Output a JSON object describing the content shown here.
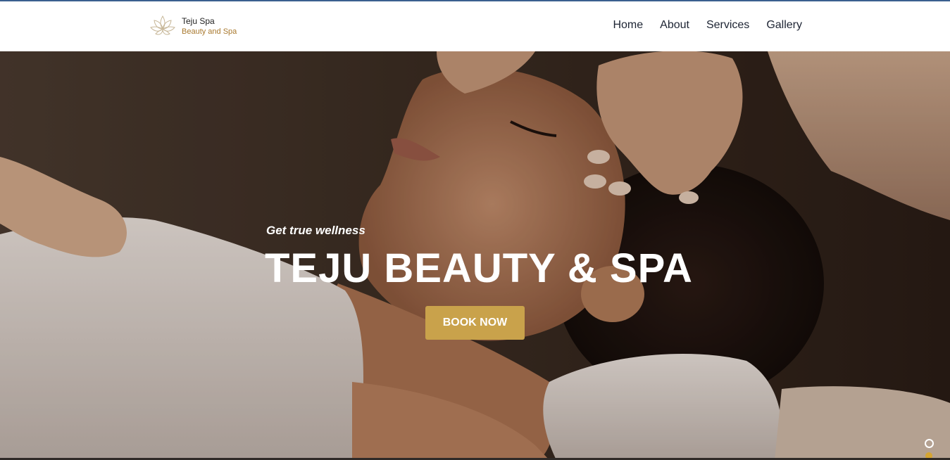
{
  "brand": {
    "name": "Teju Spa",
    "tagline": "Beauty and Spa",
    "logo_icon": "lotus-icon"
  },
  "nav": {
    "items": [
      {
        "label": "Home"
      },
      {
        "label": "About"
      },
      {
        "label": "Services"
      },
      {
        "label": "Gallery"
      }
    ]
  },
  "hero": {
    "subtitle": "Get true wellness",
    "title": "TEJU BEAUTY & SPA",
    "button_label": "BOOK NOW",
    "image": "spa-massage-photo"
  },
  "slider": {
    "dots": 2,
    "active_index": 1
  },
  "colors": {
    "accent": "#c9a24b",
    "tagline": "#a8782d",
    "nav_text": "#1d2433",
    "topline": "#3a5f8f"
  }
}
